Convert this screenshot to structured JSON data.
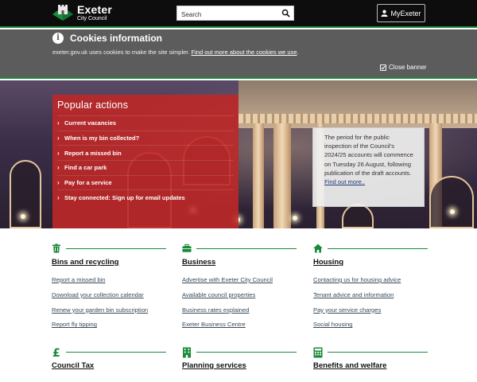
{
  "header": {
    "logo_line1": "Exeter",
    "logo_line2": "City Council",
    "search_placeholder": "Search",
    "myexeter_label": "MyExeter",
    "accent": "#1a8a3a"
  },
  "cookie_banner": {
    "title": "Cookies information",
    "text": "exeter.gov.uk uses cookies to make the site simpler. ",
    "link": "Find out more about the cookies we use",
    "suffix": ".",
    "close_label": "Close banner"
  },
  "popular_actions": {
    "title": "Popular actions",
    "items": [
      "Current vacancies",
      "When is my bin collected?",
      "Report a missed bin",
      "Find a car park",
      "Pay for a service",
      "Stay connected: Sign up for email updates"
    ],
    "color": "#be2828"
  },
  "notice": {
    "text": "The period for the public inspection of the Council's 2024/25 accounts will commence on Tuesday 26 August, following publication of the draft accounts.",
    "link": "Find out more.."
  },
  "services": [
    {
      "icon": "trash-icon",
      "title": "Bins and recycling",
      "links": [
        "Report a missed bin",
        "Download your collection calendar",
        "Renew your garden bin subscription",
        "Report fly tipping"
      ]
    },
    {
      "icon": "briefcase-icon",
      "title": "Business",
      "links": [
        "Advertise with Exeter City Council",
        "Available council properties",
        "Business rates explained",
        "Exeter Business Centre"
      ]
    },
    {
      "icon": "home-icon",
      "title": "Housing",
      "links": [
        "Contacting us for housing advice",
        "Tenant advice and information",
        "Pay your service charges",
        "Social housing"
      ]
    },
    {
      "icon": "pound-icon",
      "title": "Council Tax",
      "links": []
    },
    {
      "icon": "building-icon",
      "title": "Planning services",
      "links": []
    },
    {
      "icon": "calculator-icon",
      "title": "Benefits and welfare",
      "links": []
    }
  ]
}
